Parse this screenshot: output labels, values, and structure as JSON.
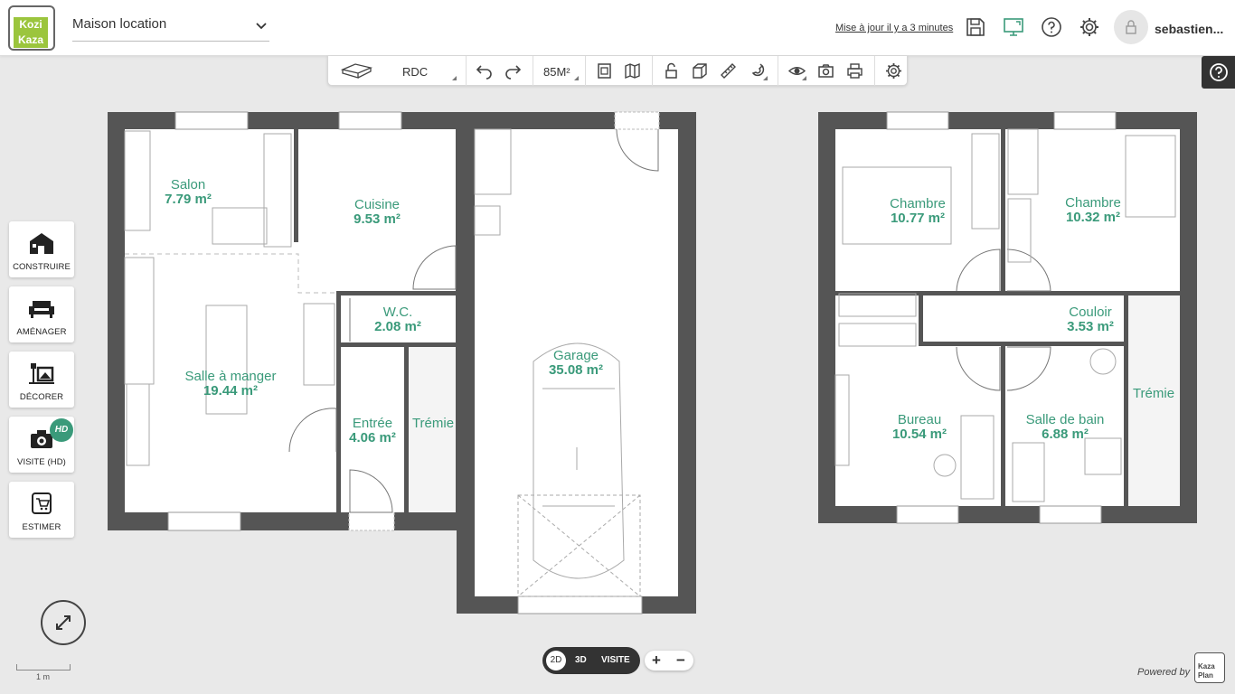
{
  "header": {
    "project_name": "Maison location",
    "save_status": "Mise à jour il y a 3 minutes",
    "username": "sebastien...",
    "logo_line1": "Kozi",
    "logo_line2": "Kaza",
    "icons": [
      "save-icon",
      "monitor-icon",
      "help-icon",
      "settings-icon",
      "lock-icon"
    ]
  },
  "toolbar": {
    "level_label": "RDC",
    "area_label": "85M²",
    "icons": [
      "level-icon",
      "undo-icon",
      "redo-icon",
      "plan-icon",
      "map-icon",
      "unlock-icon",
      "cube-icon",
      "ruler-icon",
      "magnet-icon",
      "eye-icon",
      "camera-icon",
      "print-icon",
      "settings-icon"
    ]
  },
  "sidebar": {
    "items": [
      {
        "label": "CONSTRUIRE",
        "icon": "house-icon"
      },
      {
        "label": "AMÉNAGER",
        "icon": "sofa-icon"
      },
      {
        "label": "DÉCORER",
        "icon": "decor-icon"
      },
      {
        "label": "VISITE (HD)",
        "icon": "camera-visit-icon"
      },
      {
        "label": "ESTIMER",
        "icon": "cart-icon"
      }
    ],
    "hd_badge": "HD"
  },
  "scale": {
    "label": "1 m"
  },
  "view": {
    "mode_2d": "2D",
    "mode_3d": "3D",
    "mode_visit": "VISITE",
    "active": "2D"
  },
  "zoom": {
    "plus": "+",
    "minus": "−"
  },
  "footer": {
    "powered_by": "Powered by",
    "brand_line1": "Kaza",
    "brand_line2": "Plan"
  },
  "rooms": [
    {
      "name": "Salon",
      "area": "7.79 m²"
    },
    {
      "name": "Cuisine",
      "area": "9.53 m²"
    },
    {
      "name": "W.C.",
      "area": "2.08 m²"
    },
    {
      "name": "Salle à manger",
      "area": "19.44 m²"
    },
    {
      "name": "Entrée",
      "area": "4.06 m²"
    },
    {
      "name": "Trémie",
      "area": ""
    },
    {
      "name": "Garage",
      "area": "35.08 m²"
    },
    {
      "name": "Chambre",
      "area": "10.77 m²"
    },
    {
      "name": "Chambre",
      "area": "10.32 m²"
    },
    {
      "name": "Couloir",
      "area": "3.53 m²"
    },
    {
      "name": "Trémie",
      "area": ""
    },
    {
      "name": "Bureau",
      "area": "10.54 m²"
    },
    {
      "name": "Salle de bain",
      "area": "6.88 m²"
    }
  ],
  "colors": {
    "accent": "#3a9a7a",
    "wall": "#555555",
    "brand": "#9bc53d"
  }
}
